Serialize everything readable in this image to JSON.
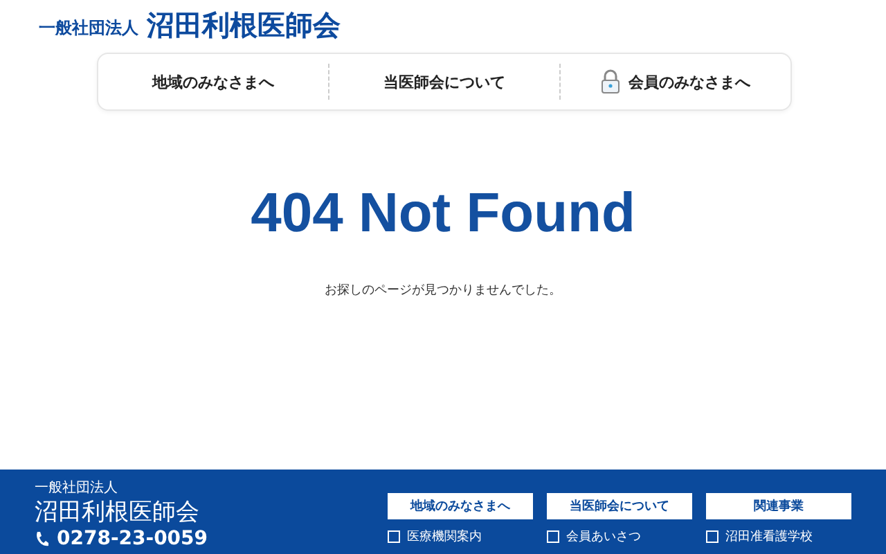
{
  "header": {
    "org_type": "一般社団法人",
    "org_name": "沼田利根医師会"
  },
  "nav": [
    {
      "label": "地域のみなさまへ",
      "locked": false
    },
    {
      "label": "当医師会について",
      "locked": false
    },
    {
      "label": "会員のみなさまへ",
      "locked": true
    }
  ],
  "main": {
    "title": "404 Not Found",
    "message": "お探しのページが見つかりませんでした。"
  },
  "footer": {
    "org_type": "一般社団法人",
    "org_name": "沼田利根医師会",
    "phone": "0278-23-0059",
    "columns": [
      {
        "heading": "地域のみなさまへ",
        "links": [
          "医療機関案内"
        ]
      },
      {
        "heading": "当医師会について",
        "links": [
          "会員あいさつ"
        ]
      },
      {
        "heading": "関連事業",
        "links": [
          "沼田准看護学校"
        ]
      }
    ]
  }
}
